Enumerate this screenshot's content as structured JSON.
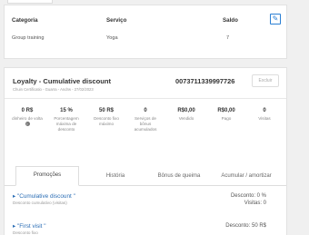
{
  "service_card": {
    "headers": [
      "Categoria",
      "Serviço",
      "Saldo"
    ],
    "row": [
      "Group training",
      "Yoga",
      "7"
    ]
  },
  "loyalty": {
    "title": "Loyalty - Cumulative discount",
    "subtitle": "Chuin Certificatio - Guarra - Andrw - 27/02/2023",
    "code": "0073711339997726",
    "exclude_label": "Excluir",
    "stats": [
      {
        "value": "0 R$",
        "label": "dinheiro de volta"
      },
      {
        "value": "15 %",
        "label": "Porcentagem máxima de desconto"
      },
      {
        "value": "50 R$",
        "label": "Desconto fixo máximo"
      },
      {
        "value": "0",
        "label": "Serviços de bônus acumulados"
      },
      {
        "value": "R$0,00",
        "label": "Vendido"
      },
      {
        "value": "R$0,00",
        "label": "Pago"
      },
      {
        "value": "0",
        "label": "Visitas"
      }
    ],
    "tabs": [
      "Promoções",
      "História",
      "Bônus de queima",
      "Acumular / amortizar"
    ],
    "promotions": [
      {
        "name": "\"Cumulative discount \"",
        "desc": "Desconto cumulativo (visitas)",
        "right1": "Desconto: 0 %",
        "right2": "Visitas: 0"
      },
      {
        "name": "\"First visit \"",
        "desc": "Desconto fixo",
        "right1": "Desconto: 50 R$",
        "right2": ""
      }
    ]
  }
}
